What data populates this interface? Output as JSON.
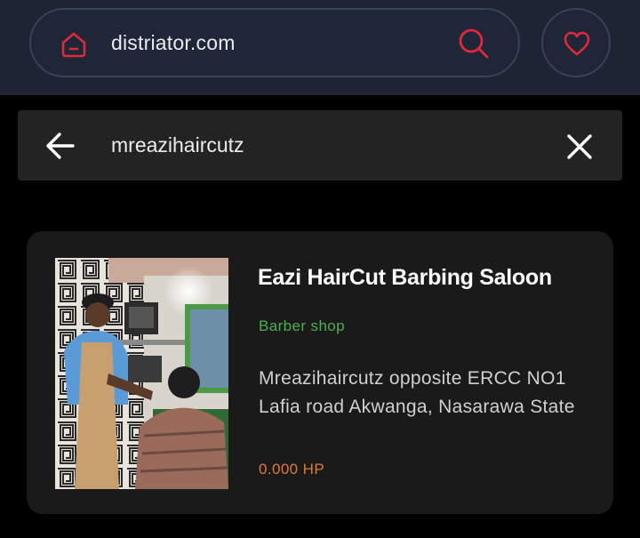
{
  "browser": {
    "url": "distriator.com",
    "icons": {
      "home": "home-icon",
      "search": "search-icon",
      "favorite": "heart-icon"
    },
    "accent_color": "#e0293b"
  },
  "search": {
    "query": "mreazihaircutz",
    "icons": {
      "back": "arrow-left-icon",
      "clear": "close-icon"
    }
  },
  "results": [
    {
      "title": "Eazi HairCut Barbing Saloon",
      "category": "Barber shop",
      "address": "Mreazihaircutz opposite ERCC NO1 Lafia road Akwanga, Nasarawa State",
      "price": "0.000 HP",
      "category_color": "#4caf50",
      "price_color": "#e07a30"
    }
  ]
}
